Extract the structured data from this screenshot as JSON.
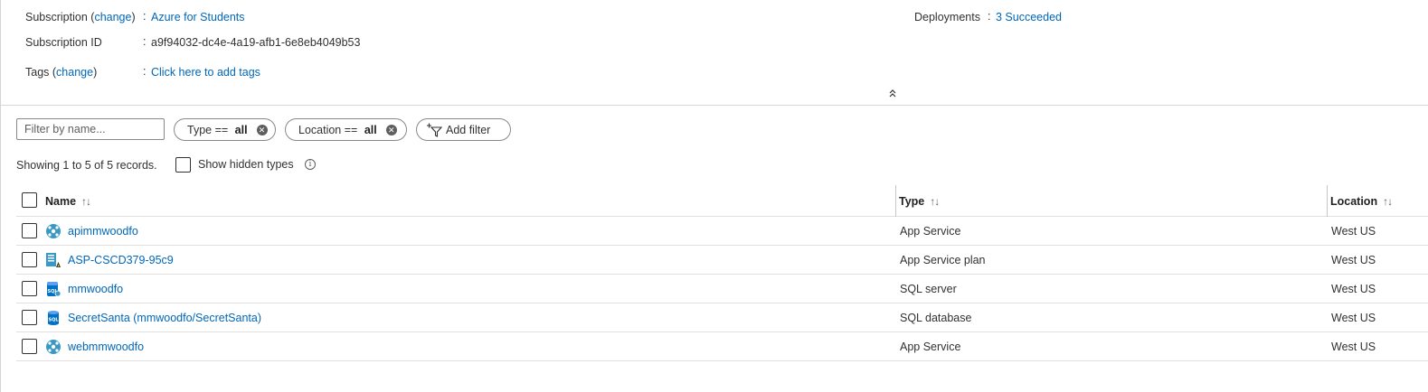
{
  "essentials": {
    "subscription_label": "Subscription",
    "subscription_change": "change",
    "subscription_value": "Azure for Students",
    "subscription_id_label": "Subscription ID",
    "subscription_id_value": "a9f94032-dc4e-4a19-afb1-6e8eb4049b53",
    "tags_label": "Tags",
    "tags_change": "change",
    "tags_value": "Click here to add tags",
    "deployments_label": "Deployments",
    "deployments_value": "3 Succeeded"
  },
  "filters": {
    "search_placeholder": "Filter by name...",
    "type_prefix": "Type == ",
    "type_value": "all",
    "location_prefix": "Location == ",
    "location_value": "all",
    "add_filter_label": "Add filter"
  },
  "records_text": "Showing 1 to 5 of 5 records.",
  "show_hidden_label": "Show hidden types",
  "table": {
    "columns": {
      "name": "Name",
      "type": "Type",
      "location": "Location"
    },
    "rows": [
      {
        "name": "apimmwoodfo",
        "type": "App Service",
        "location": "West US",
        "icon": "app-service-icon"
      },
      {
        "name": "ASP-CSCD379-95c9",
        "type": "App Service plan",
        "location": "West US",
        "icon": "app-service-plan-icon"
      },
      {
        "name": "mmwoodfo",
        "type": "SQL server",
        "location": "West US",
        "icon": "sql-server-icon"
      },
      {
        "name": "SecretSanta (mmwoodfo/SecretSanta)",
        "type": "SQL database",
        "location": "West US",
        "icon": "sql-database-icon"
      },
      {
        "name": "webmmwoodfo",
        "type": "App Service",
        "location": "West US",
        "icon": "app-service-icon"
      }
    ]
  },
  "colors": {
    "link": "#0067b8",
    "text": "#323130",
    "border": "#8a8886"
  }
}
